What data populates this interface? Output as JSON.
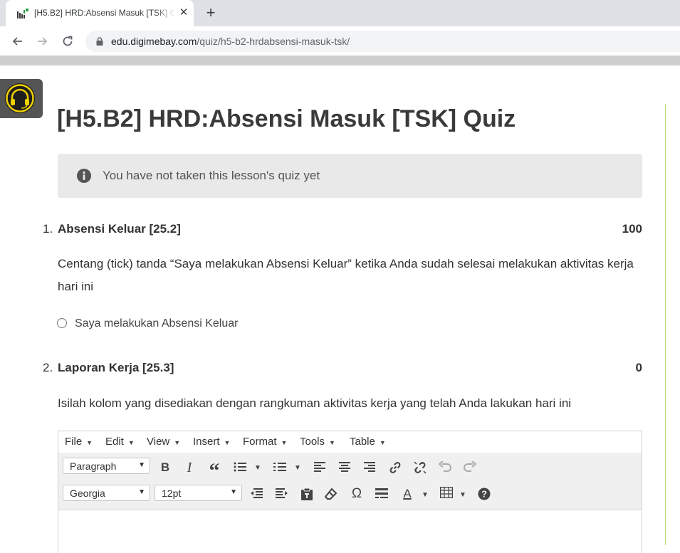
{
  "browser": {
    "tab_title": "[H5.B2] HRD:Absensi Masuk [TSK] Quiz",
    "close_symbol": "✕",
    "new_tab_symbol": "+",
    "url_host": "edu.digimebay.com",
    "url_path": "/quiz/h5-b2-hrdabsensi-masuk-tsk/",
    "icons": [
      "back-icon",
      "forward-icon",
      "reload-icon",
      "lock-icon"
    ]
  },
  "page": {
    "title": "[H5.B2] HRD:Absensi Masuk [TSK] Quiz",
    "notice": "You have not taken this lesson's quiz yet",
    "accent_color": "#b9e07a"
  },
  "questions": [
    {
      "number": "1.",
      "title": "Absensi Keluar [25.2]",
      "points": "100",
      "text": "Centang (tick) tanda “Saya melakukan Absensi Keluar” ketika Anda sudah selesai melakukan aktivitas kerja hari ini",
      "answer": "Saya melakukan Absensi Keluar"
    },
    {
      "number": "2.",
      "title": "Laporan Kerja [25.3]",
      "points": "0",
      "text": "Isilah kolom yang disediakan dengan rangkuman aktivitas kerja yang telah Anda lakukan hari ini"
    }
  ],
  "editor": {
    "menu": {
      "file": "File",
      "edit": "Edit",
      "view": "View",
      "insert": "Insert",
      "format": "Format",
      "tools": "Tools",
      "table": "Table"
    },
    "block_format": "Paragraph",
    "font_family": "Georgia",
    "font_size": "12pt",
    "glyphs": {
      "bold": "B",
      "italic": "I",
      "blockquote": "“",
      "omega": "Ω",
      "help": "?",
      "text_color": "A"
    }
  }
}
